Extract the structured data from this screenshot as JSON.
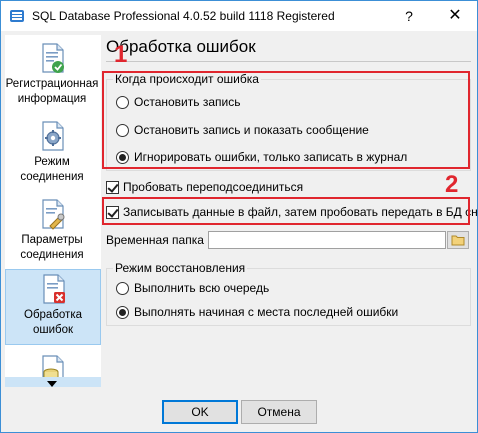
{
  "window": {
    "title": "SQL Database Professional 4.0.52 build 1118 Registered",
    "help_label": "?",
    "close_label": "✕"
  },
  "sidebar": {
    "items": [
      {
        "label": "Регистрационная информация",
        "icon": "registration-doc-icon",
        "selected": false
      },
      {
        "label": "Режим соединения",
        "icon": "connection-mode-gear-icon",
        "selected": false
      },
      {
        "label": "Параметры соединения",
        "icon": "connection-params-wrench-icon",
        "selected": false
      },
      {
        "label": "Обработка ошибок",
        "icon": "error-handling-icon",
        "selected": true
      },
      {
        "label": "",
        "icon": "database-doc-icon",
        "selected": false
      }
    ]
  },
  "page": {
    "title": "Обработка ошибок",
    "when_error_group": {
      "legend": "Когда происходит ошибка",
      "options": [
        {
          "label": "Остановить запись",
          "checked": false
        },
        {
          "label": "Остановить запись и показать сообщение",
          "checked": false
        },
        {
          "label": "Игнорировать ошибки, только записать в журнал",
          "checked": true
        }
      ]
    },
    "reconnect": {
      "label": "Пробовать переподсоединиться",
      "checked": true
    },
    "write_to_file": {
      "label": "Записывать данные в файл, затем пробовать передать в БД снова",
      "checked": true
    },
    "temp_folder": {
      "label": "Временная папка",
      "value": ""
    },
    "recovery_group": {
      "legend": "Режим восстановления",
      "options": [
        {
          "label": "Выполнить всю очередь",
          "checked": false
        },
        {
          "label": "Выполнять начиная с места последней ошибки",
          "checked": true
        }
      ]
    },
    "annotations": {
      "first": "1",
      "second": "2"
    }
  },
  "footer": {
    "ok_label": "OK",
    "cancel_label": "Отмена"
  },
  "colors": {
    "accent": "#0078d7",
    "selected_bg": "#cce4f7",
    "annotation_red": "#e0262e"
  }
}
